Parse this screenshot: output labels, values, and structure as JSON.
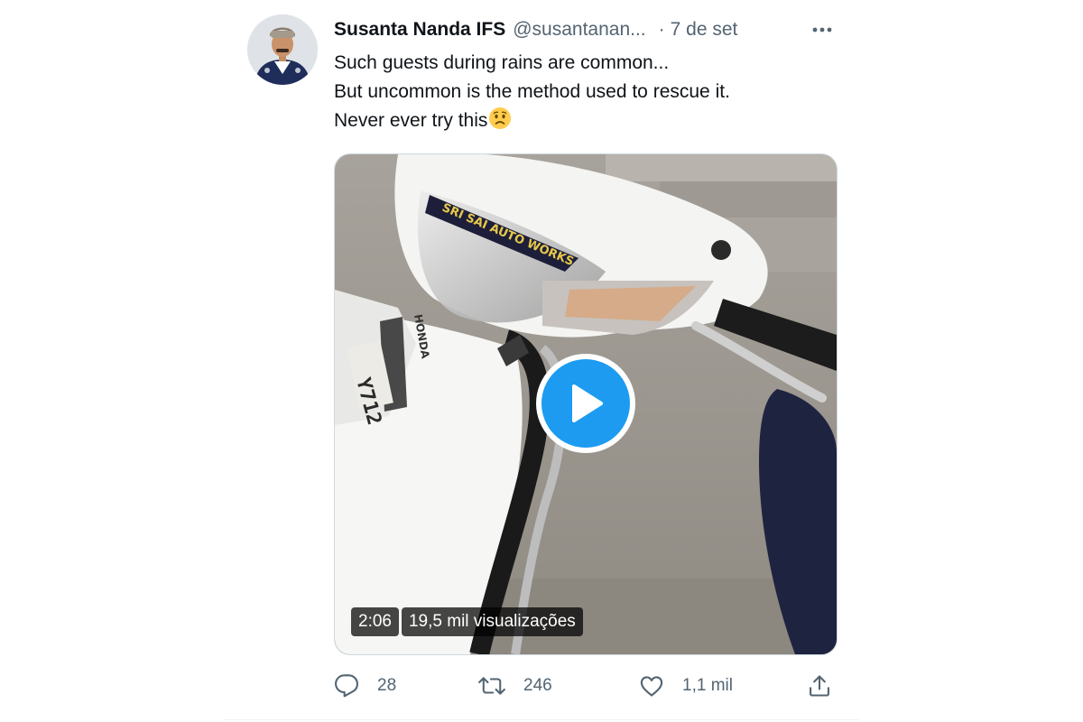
{
  "tweet": {
    "display_name": "Susanta Nanda IFS",
    "handle": "@susantanan...",
    "separator": "·",
    "date": "7 de set",
    "text_lines": [
      "Such guests during rains are common...",
      "But uncommon is the method used to rescue it.",
      "Never ever try this"
    ],
    "video": {
      "duration": "2:06",
      "views": "19,5 mil visualizações",
      "sticker_text": "SRI SAI AUTO WORKS",
      "brand_text": "HONDA",
      "plate_text": "Y712"
    },
    "actions": {
      "reply_count": "28",
      "retweet_count": "246",
      "like_count": "1,1 mil"
    }
  },
  "colors": {
    "accent": "#1d9bf0",
    "secondary_text": "#536471",
    "primary_text": "#0f1419"
  },
  "icons": [
    "more-icon",
    "play-icon",
    "reply-icon",
    "retweet-icon",
    "like-icon",
    "share-icon",
    "worried-face-emoji"
  ]
}
